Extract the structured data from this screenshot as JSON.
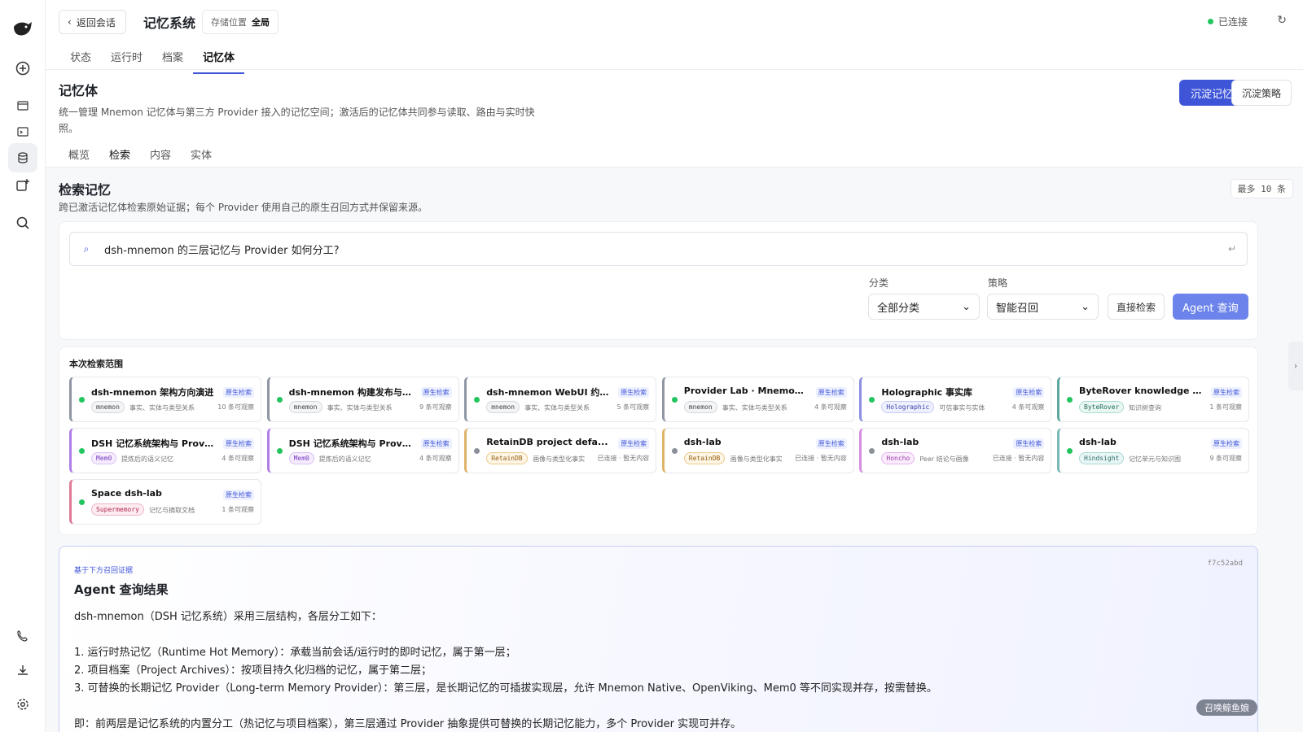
{
  "nav": {
    "back_label": "返回会话",
    "title": "记忆系统",
    "storage_label": "存储位置",
    "storage_value": "全局",
    "status": "已连接",
    "tabs": [
      "状态",
      "运行时",
      "档案",
      "记忆体"
    ]
  },
  "section": {
    "title": "记忆体",
    "description": "统一管理 Mnemon 记忆体与第三方 Provider 接入的记忆空间；激活后的记忆体共同参与读取、路由与实时快照。",
    "primary_button": "沉淀记忆",
    "secondary_button": "沉淀策略",
    "subtabs": [
      "概览",
      "检索",
      "内容",
      "实体"
    ]
  },
  "search": {
    "title": "检索记忆",
    "description": "跨已激活记忆体检索原始证据；每个 Provider 使用自己的原生召回方式并保留来源。",
    "max_badge": "最多 10 条",
    "query": "dsh-mnemon 的三层记忆与 Provider 如何分工?",
    "category_label": "分类",
    "category_value": "全部分类",
    "strategy_label": "策略",
    "strategy_value": "智能召回",
    "direct_button": "直接检索",
    "agent_button": "Agent 查询"
  },
  "scope": {
    "title": "本次检索范围",
    "cards": [
      {
        "name": "dsh-mnemon 架构方向演进",
        "badge": "原生检索",
        "tag": "mnemon",
        "desc": "事实、实体与类型关系",
        "count": "10 条可观察",
        "status": "green",
        "accent": "#8f96a3"
      },
      {
        "name": "dsh-mnemon 构建发布与开...",
        "badge": "原生检索",
        "tag": "mnemon",
        "desc": "事实、实体与类型关系",
        "count": "9 条可观察",
        "status": "green",
        "accent": "#8f96a3"
      },
      {
        "name": "dsh-mnemon WebUI 约定与...",
        "badge": "原生检索",
        "tag": "mnemon",
        "desc": "事实、实体与类型关系",
        "count": "5 条可观察",
        "status": "green",
        "accent": "#8f96a3"
      },
      {
        "name": "Provider Lab · Mnemon Nat...",
        "badge": "原生检索",
        "tag": "mnemon",
        "desc": "事实、实体与类型关系",
        "count": "4 条可观察",
        "status": "green",
        "accent": "#8f96a3"
      },
      {
        "name": "Holographic 事实库",
        "badge": "原生检索",
        "tag": "Holographic",
        "desc": "可信事实与实体",
        "count": "4 条可观察",
        "status": "green",
        "accent": "#8b8fe0"
      },
      {
        "name": "ByteRover knowledge tree",
        "badge": "原生检索",
        "tag": "ByteRover",
        "desc": "知识树查询",
        "count": "1 条可观察",
        "status": "green",
        "accent": "#5fa8a0"
      },
      {
        "name": "DSH 记忆系统架构与 Provide...",
        "badge": "原生检索",
        "tag": "Mem0",
        "desc": "提炼后的语义记忆",
        "count": "4 条可观察",
        "status": "green",
        "accent": "#b07ee6"
      },
      {
        "name": "DSH 记忆系统架构与 Provide...",
        "badge": "原生检索",
        "tag": "Mem0",
        "desc": "提炼后的语义记忆",
        "count": "4 条可观察",
        "status": "green",
        "accent": "#b07ee6"
      },
      {
        "name": "RetainDB project defa...",
        "badge": "原生检索",
        "tag": "RetainDB",
        "desc": "画像与类型化事实",
        "count": "已连接 · 暂无内容",
        "status": "grey",
        "accent": "#e0b36a"
      },
      {
        "name": "dsh-lab",
        "badge": "原生检索",
        "tag": "RetainDB",
        "desc": "画像与类型化事实",
        "count": "已连接 · 暂无内容",
        "status": "grey",
        "accent": "#e0b36a"
      },
      {
        "name": "dsh-lab",
        "badge": "原生检索",
        "tag": "Honcho",
        "desc": "Peer 结论与画像",
        "count": "已连接 · 暂无内容",
        "status": "grey",
        "accent": "#d48fe0"
      },
      {
        "name": "dsh-lab",
        "badge": "原生检索",
        "tag": "Hindsight",
        "desc": "记忆单元与知识图",
        "count": "9 条可观察",
        "status": "green",
        "accent": "#7ab8b6"
      },
      {
        "name": "Space dsh-lab",
        "badge": "原生检索",
        "tag": "Supermemory",
        "desc": "记忆与摘取文档",
        "count": "1 条可观察",
        "status": "green",
        "accent": "#e07a96"
      }
    ]
  },
  "result": {
    "kicker": "基于下方召回证据",
    "hash": "f7c52abd",
    "title": "Agent 查询结果",
    "body": "dsh-mnemon（DSH 记忆系统）采用三层结构，各层分工如下：\n\n1. 运行时热记忆（Runtime Hot Memory）：承载当前会话/运行时的即时记忆，属于第一层；\n2. 项目档案（Project Archives）：按项目持久化归档的记忆，属于第二层；\n3. 可替换的长期记忆 Provider（Long-term Memory Provider）：第三层，是长期记忆的可插拔实现层，允许 Mnemon Native、OpenViking、Mem0 等不同实现并存，按需替换。\n\n即：前两层是记忆系统的内置分工（热记忆与项目档案），第三层通过 Provider 抽象提供可替换的长期记忆能力，多个 Provider 实现可并存。"
  },
  "float_tag": "召唤鲸鱼娘",
  "colors": {
    "accent": "#3e55d8",
    "connected": "#22c55e"
  }
}
